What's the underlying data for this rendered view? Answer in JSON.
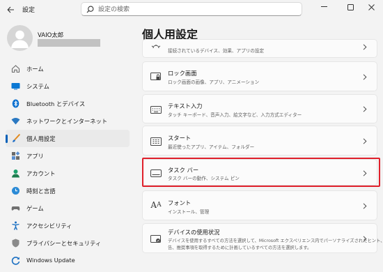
{
  "app": {
    "title": "設定",
    "search_placeholder": "設定の検索"
  },
  "window_controls": {
    "minimize": "minimize-icon",
    "maximize": "maximize-icon",
    "close": "close-icon"
  },
  "profile": {
    "name": "VAIO太郎"
  },
  "sidebar": {
    "items": [
      {
        "label": "ホーム",
        "icon": "home-icon"
      },
      {
        "label": "システム",
        "icon": "system-icon"
      },
      {
        "label": "Bluetooth とデバイス",
        "icon": "bluetooth-icon"
      },
      {
        "label": "ネットワークとインターネット",
        "icon": "network-icon"
      },
      {
        "label": "個人用設定",
        "icon": "brush-icon",
        "active": true
      },
      {
        "label": "アプリ",
        "icon": "apps-icon"
      },
      {
        "label": "アカウント",
        "icon": "account-icon"
      },
      {
        "label": "時刻と言語",
        "icon": "time-language-icon"
      },
      {
        "label": "ゲーム",
        "icon": "game-icon"
      },
      {
        "label": "アクセシビリティ",
        "icon": "accessibility-icon"
      },
      {
        "label": "プライバシーとセキュリティ",
        "icon": "shield-icon"
      },
      {
        "label": "Windows Update",
        "icon": "windows-update-icon"
      }
    ]
  },
  "main": {
    "page_title": "個人用設定",
    "cards": [
      {
        "title": "",
        "subtitle": "接続されているデバイス、効果、アプリの設定",
        "icon": "lighting-icon"
      },
      {
        "title": "ロック画面",
        "subtitle": "ロック画面の画像、アプリ、アニメーション",
        "icon": "lock-screen-icon"
      },
      {
        "title": "テキスト入力",
        "subtitle": "タッチ キーボード、音声入力、絵文字など、入力方式エディター",
        "icon": "keyboard-icon"
      },
      {
        "title": "スタート",
        "subtitle": "最近使ったアプリ、アイテム、フォルダー",
        "icon": "start-icon"
      },
      {
        "title": "タスク バー",
        "subtitle": "タスク バーの動作、システム ピン",
        "icon": "taskbar-icon"
      },
      {
        "title": "フォント",
        "subtitle": "インストール、管理",
        "icon": "font-icon"
      },
      {
        "title": "デバイスの使用状況",
        "subtitle": "デバイスを使用するすべての方法を選択して、Microsoft エクスペリエンス内でパーソナライズされたヒント、広",
        "subtitle2": "告、推奨事項を取得するために計画しているすべての方法を選択します。",
        "icon": "device-usage-icon"
      }
    ]
  },
  "colors": {
    "accent": "#005fb8",
    "highlight_border": "#e0202b"
  }
}
